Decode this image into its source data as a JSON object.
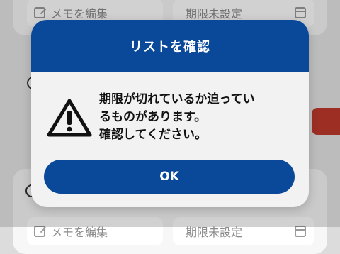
{
  "background": {
    "top_card": {
      "memo_label": "メモを編集",
      "due_label": "期限未設定"
    },
    "bottom_card": {
      "memo_label": "メモを編集",
      "due_label": "期限未設定"
    }
  },
  "dialog": {
    "title": "リストを確認",
    "message_line1": "期限が切れているか迫ってい",
    "message_line2": "るものがあります。",
    "message_line3": "確認してください。",
    "ok_label": "OK",
    "icon": "warning-icon"
  },
  "colors": {
    "accent": "#0a489a",
    "danger": "#c0392b"
  }
}
